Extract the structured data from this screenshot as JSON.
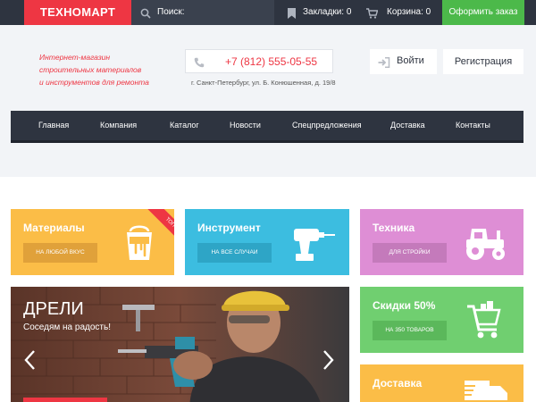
{
  "colors": {
    "dark": "#2e3440",
    "red": "#ee3643",
    "green": "#4cb94a",
    "yellow": "#fbbd47",
    "blue": "#3cbde0",
    "pink": "#de8ed5",
    "light_green": "#70cf70",
    "header_bg": "#f2f4f7"
  },
  "topbar": {
    "logo": "ТЕХНОМАРТ",
    "search_label": "Поиск:",
    "bookmarks": "Закладки: 0",
    "cart": "Корзина: 0",
    "order": "Оформить заказ"
  },
  "header": {
    "tagline": [
      "Интернет-магазин",
      "строительных материалов",
      "и инструментов для ремонта"
    ],
    "phone": "+7 (812) 555-05-55",
    "address": "г. Санкт-Петербург, ул. Б. Конюшенная, д. 19/8",
    "login": "Войти",
    "register": "Регистрация"
  },
  "nav": [
    "Главная",
    "Компания",
    "Каталог",
    "Новости",
    "Спецпредложения",
    "Доставка",
    "Контакты"
  ],
  "tiles": {
    "materials": {
      "title": "Материалы",
      "button": "НА ЛЮБОЙ ВКУС",
      "ribbon": "ТОП",
      "icon": "paint-bucket-icon"
    },
    "tools": {
      "title": "Инструмент",
      "button": "НА ВСЕ СЛУЧАИ",
      "icon": "drill-icon"
    },
    "machinery": {
      "title": "Техника",
      "button": "ДЛЯ СТРОЙКИ",
      "icon": "tractor-icon"
    },
    "sale": {
      "title": "Скидки 50%",
      "button": "НА 350 ТОВАРОВ",
      "icon": "shopping-cart-icon"
    },
    "delivery": {
      "title": "Доставка",
      "icon": "truck-icon"
    }
  },
  "slider": {
    "headline": "ДРЕЛИ",
    "subheadline": "Соседям на радость!"
  }
}
